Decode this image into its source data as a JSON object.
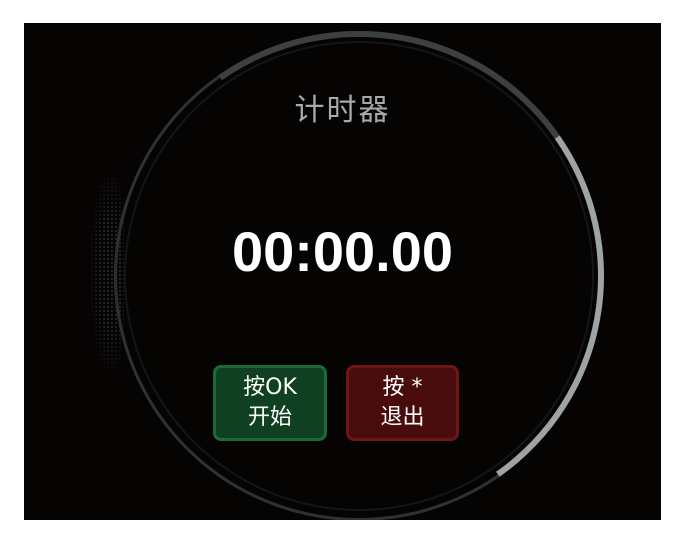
{
  "screen": {
    "title": "计时器",
    "time_display": "00:00.00"
  },
  "buttons": {
    "start": {
      "line1": "按OK",
      "line2": "开始",
      "color": "#0f4021",
      "border_color": "#1c6a36"
    },
    "exit": {
      "line1": "按 *",
      "line2": "退出",
      "color": "#480c0c",
      "border_color": "#6e1616"
    }
  },
  "colors": {
    "background": "#060303",
    "title_text": "#a9a9a9",
    "time_text": "#ffffff",
    "ring": "#9ea3a6"
  }
}
